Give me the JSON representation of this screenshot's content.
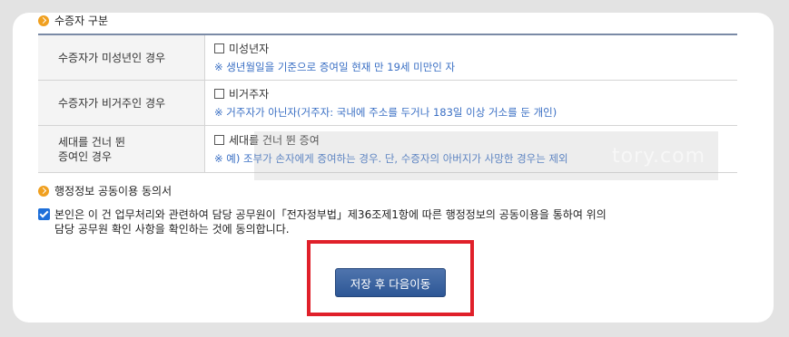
{
  "recipient_section": {
    "title": "수증자 구분",
    "rows": [
      {
        "label": "수증자가 미성년인 경우",
        "checkbox_label": "미성년자",
        "checked": false,
        "note": "※ 생년월일을 기준으로 증여일 현재 만 19세 미만인 자"
      },
      {
        "label": "수증자가 비거주인 경우",
        "checkbox_label": "비거주자",
        "checked": false,
        "note": "※ 거주자가 아닌자(거주자: 국내에 주소를 두거나 183일 이상 거소를 둔 개인)"
      },
      {
        "label_line1": "세대를 건너 뛴",
        "label_line2": "증여인 경우",
        "checkbox_label": "세대를 건너 뛴 증여",
        "checked": false,
        "note": "※ 예) 조부가 손자에게 증여하는 경우. 단, 수증자의 아버지가 사망한 경우는 제외"
      }
    ]
  },
  "consent_section": {
    "title": "행정정보 공동이용 동의서",
    "checked": true,
    "line1": "본인은 이 건 업무처리와 관련하여 담당 공무원이「전자정부법」제36조제1항에 따른 행정정보의 공동이용을 통하여 위의",
    "line2": "담당 공무원 확인 사항을 확인하는 것에 동의합니다."
  },
  "actions": {
    "save_next_label": "저장 후 다음이동"
  },
  "watermark": {
    "text": "tory.com"
  },
  "colors": {
    "accent_bullet": "#f0a020",
    "note_text": "#3a6fc4",
    "button": "#3a62a0",
    "highlight": "#e0202a",
    "checkbox_checked": "#1e6fd9"
  }
}
